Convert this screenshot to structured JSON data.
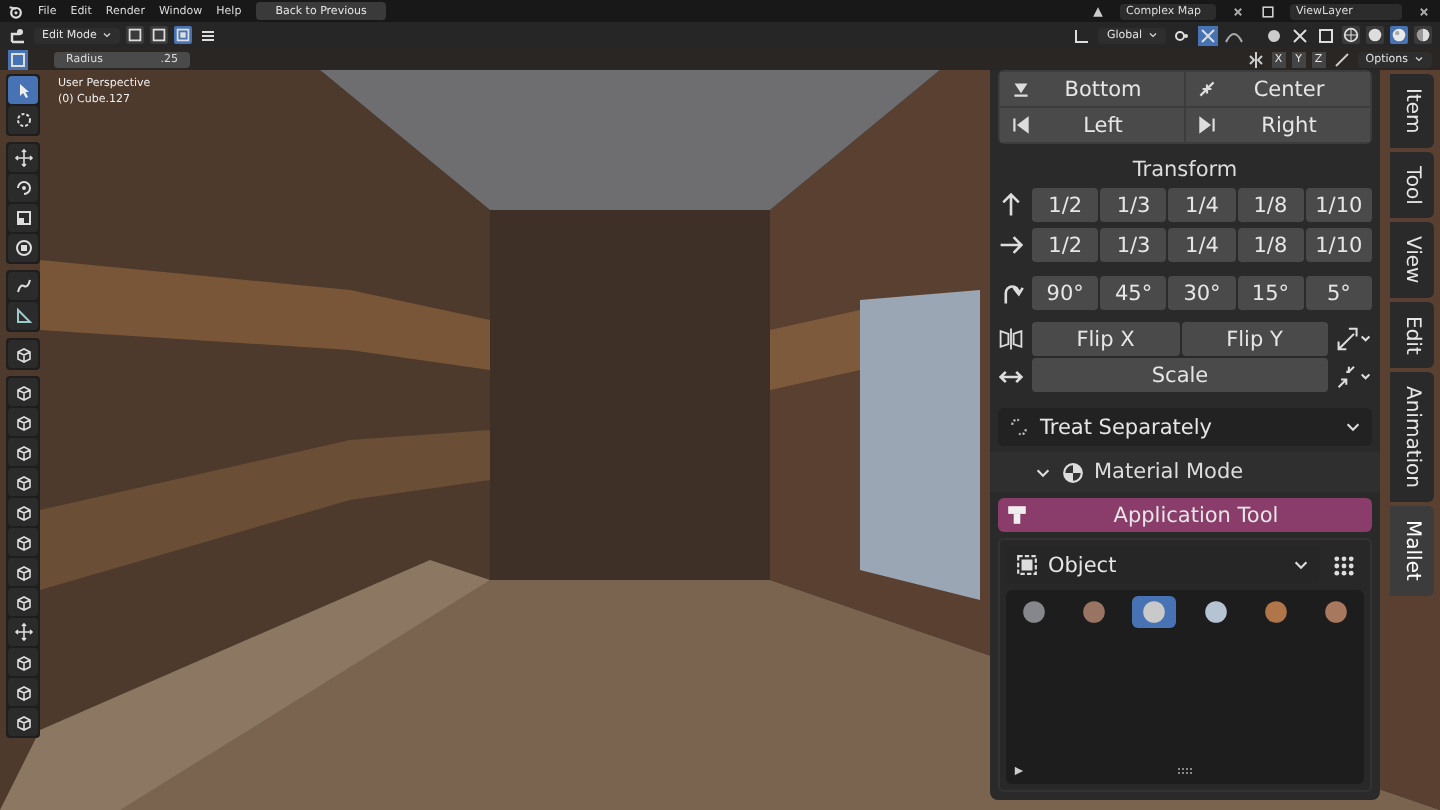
{
  "menu_bar": {
    "menus": [
      "File",
      "Edit",
      "Render",
      "Window",
      "Help"
    ],
    "back_button": "Back to Previous",
    "scene": "Complex Map",
    "view_layer": "ViewLayer"
  },
  "header": {
    "mode": "Edit Mode",
    "select_modes": [
      {
        "kind": "vertex",
        "selected": false
      },
      {
        "kind": "edge",
        "selected": false
      },
      {
        "kind": "face",
        "selected": true
      }
    ],
    "orientation": "Global",
    "snap_on": true,
    "shading_modes": [
      {
        "kind": "wireframe",
        "selected": false
      },
      {
        "kind": "solid",
        "selected": false
      },
      {
        "kind": "material",
        "selected": true
      },
      {
        "kind": "rendered",
        "selected": false
      }
    ]
  },
  "tool_settings": {
    "label": "Radius",
    "value": ".25",
    "mirror_axes": [
      "X",
      "Y",
      "Z"
    ],
    "options": "Options"
  },
  "viewport": {
    "view_name": "User Perspective",
    "object": "(0) Cube.127"
  },
  "toolbar": {
    "groups": [
      [
        {
          "kind": "select",
          "selected": true
        },
        {
          "kind": "cursor",
          "selected": false
        }
      ],
      [
        {
          "kind": "move",
          "selected": false
        },
        {
          "kind": "rotate",
          "selected": false
        },
        {
          "kind": "scale",
          "selected": false
        },
        {
          "kind": "transform",
          "selected": false
        }
      ],
      [
        {
          "kind": "annotate",
          "selected": false
        },
        {
          "kind": "measure",
          "selected": false
        }
      ],
      [
        {
          "kind": "cube",
          "selected": false
        }
      ],
      [
        {
          "kind": "cube",
          "selected": false
        },
        {
          "kind": "cube",
          "selected": false
        },
        {
          "kind": "cube",
          "selected": false
        },
        {
          "kind": "cube",
          "selected": false
        },
        {
          "kind": "cube",
          "selected": false
        },
        {
          "kind": "cube",
          "selected": false
        },
        {
          "kind": "cube",
          "selected": false
        },
        {
          "kind": "cube",
          "selected": false
        },
        {
          "kind": "move",
          "selected": false
        },
        {
          "kind": "cube",
          "selected": false
        },
        {
          "kind": "cube",
          "selected": false
        },
        {
          "kind": "cube",
          "selected": false
        }
      ]
    ]
  },
  "sidebar": {
    "align_buttons": [
      {
        "kind": "bottom",
        "label": "Bottom"
      },
      {
        "kind": "center",
        "label": "Center"
      },
      {
        "kind": "left",
        "label": "Left"
      },
      {
        "kind": "right",
        "label": "Right"
      }
    ],
    "transform": {
      "title": "Transform",
      "rows": [
        {
          "kind": "up",
          "values": [
            "1/2",
            "1/3",
            "1/4",
            "1/8",
            "1/10"
          ]
        },
        {
          "kind": "right",
          "values": [
            "1/2",
            "1/3",
            "1/4",
            "1/8",
            "1/10"
          ]
        },
        {
          "kind": "rotate",
          "values": [
            "90°",
            "45°",
            "30°",
            "15°",
            "5°"
          ]
        }
      ],
      "flip_buttons": [
        "Flip X",
        "Flip Y"
      ],
      "scale_button": "Scale"
    },
    "treat_dropdown": "Treat Separately",
    "material_mode": {
      "title": "Material Mode",
      "expanded": true
    },
    "application_tool": "Application Tool",
    "object_dropdown": "Object",
    "materials": [
      {
        "color": "#85878c",
        "selected": false
      },
      {
        "color": "#9a7462",
        "selected": false
      },
      {
        "color": "#c9c9c9",
        "selected": true
      },
      {
        "color": "#b5c3d2",
        "selected": false
      },
      {
        "color": "#b07548",
        "selected": false
      },
      {
        "color": "#a8785e",
        "selected": false
      }
    ]
  },
  "tabs": [
    {
      "label": "Item",
      "selected": false
    },
    {
      "label": "Tool",
      "selected": false
    },
    {
      "label": "View",
      "selected": false
    },
    {
      "label": "Edit",
      "selected": false
    },
    {
      "label": "Animation",
      "selected": false
    },
    {
      "label": "Mallet",
      "selected": true
    }
  ]
}
